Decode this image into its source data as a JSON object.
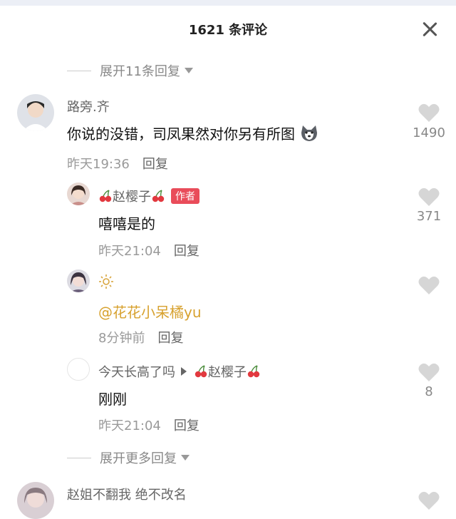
{
  "header": {
    "title": "1621 条评论"
  },
  "expand_top": {
    "label": "展开11条回复"
  },
  "comments": [
    {
      "name": "路旁.齐",
      "text": "你说的没错，司凤果然对你另有所图",
      "time": "昨天19:36",
      "reply": "回复",
      "likes": "1490"
    },
    {
      "name": "赵樱子",
      "badge": "作者",
      "text": "嘻嘻是的",
      "time": "昨天21:04",
      "reply": "回复",
      "likes": "371"
    },
    {
      "name": "☼",
      "text": "@花花小呆橘yu",
      "time": "8分钟前",
      "reply": "回复",
      "likes": ""
    },
    {
      "name": "今天长高了吗",
      "reply_to": "赵樱子",
      "text": "刚刚",
      "time": "昨天21:04",
      "reply": "回复",
      "likes": "8"
    },
    {
      "name": "赵姐不翻我 绝不改名",
      "likes": ""
    }
  ],
  "expand_more": {
    "label": "展开更多回复"
  },
  "colors": {
    "accent_badge": "#e94c5a",
    "mention": "#d7a12e"
  }
}
